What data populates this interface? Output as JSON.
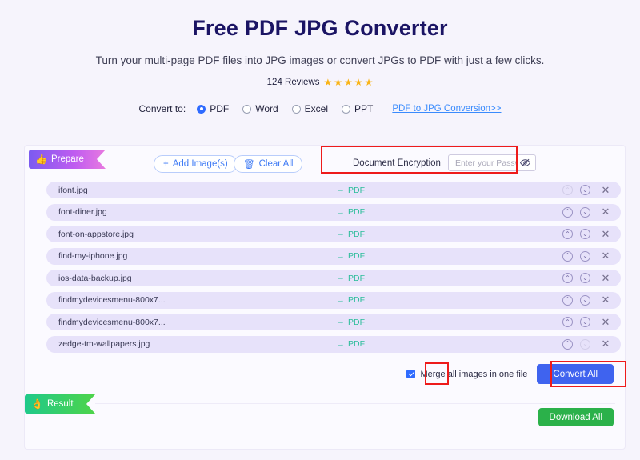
{
  "header": {
    "title": "Free PDF JPG Converter",
    "subtitle": "Turn your multi-page PDF files into JPG images or convert JPGs to PDF with just a few clicks.",
    "reviews_count": "124 Reviews",
    "star_glyph": "★",
    "stars": 5,
    "star_color": "#f9b418",
    "title_color": "#1b1464"
  },
  "convert": {
    "label": "Convert to:",
    "options": [
      {
        "label": "PDF",
        "selected": true
      },
      {
        "label": "Word",
        "selected": false
      },
      {
        "label": "Excel",
        "selected": false
      },
      {
        "label": "PPT",
        "selected": false
      }
    ],
    "link": "PDF to JPG Conversion>>",
    "link_color": "#3a8bfd",
    "accent_color": "#2f6bff"
  },
  "prepare_section": {
    "ribbon_label": "Prepare",
    "ribbon_icon": "thumbs-up-icon",
    "ribbon_icon_glyph": "👍",
    "add_images_label": "Add Image(s)",
    "add_images_icon": "plus-icon",
    "add_images_glyph": "+",
    "clear_all_label": "Clear All",
    "clear_all_icon": "trash-icon",
    "clear_all_glyph": "🗑",
    "encryption_label": "Document Encryption",
    "password_placeholder": "Enter your Password.",
    "password_value": "",
    "eye_icon": "eye-slash-icon"
  },
  "files": {
    "target_format": "PDF",
    "arrow_glyph": "→",
    "up_glyph": "⌃",
    "down_glyph": "⌄",
    "close_glyph": "✕",
    "rows": [
      {
        "name": "ifont.jpg",
        "target": "PDF",
        "up_disabled": true
      },
      {
        "name": "font-diner.jpg",
        "target": "PDF",
        "up_disabled": false
      },
      {
        "name": "font-on-appstore.jpg",
        "target": "PDF",
        "up_disabled": false
      },
      {
        "name": "find-my-iphone.jpg",
        "target": "PDF",
        "up_disabled": false
      },
      {
        "name": "ios-data-backup.jpg",
        "target": "PDF",
        "up_disabled": false
      },
      {
        "name": "findmydevicesmenu-800x7...",
        "target": "PDF",
        "up_disabled": false
      },
      {
        "name": "findmydevicesmenu-800x7...",
        "target": "PDF",
        "up_disabled": false
      },
      {
        "name": "zedge-tm-wallpapers.jpg",
        "target": "PDF",
        "up_disabled": false
      }
    ]
  },
  "footer": {
    "merge_label": "Merge all images in one file",
    "merge_checked": true,
    "convert_all_label": "Convert All",
    "convert_all_color": "#3f63ef",
    "result_ribbon_label": "Result",
    "result_ribbon_icon": "ok-hand-icon",
    "result_ribbon_glyph": "👌",
    "download_all_label": "Download All",
    "download_all_color": "#2bb14a"
  },
  "annotations": {
    "color": "#ee1b1b",
    "boxes": [
      "document-encryption",
      "merge-checkbox",
      "convert-all-button"
    ]
  }
}
